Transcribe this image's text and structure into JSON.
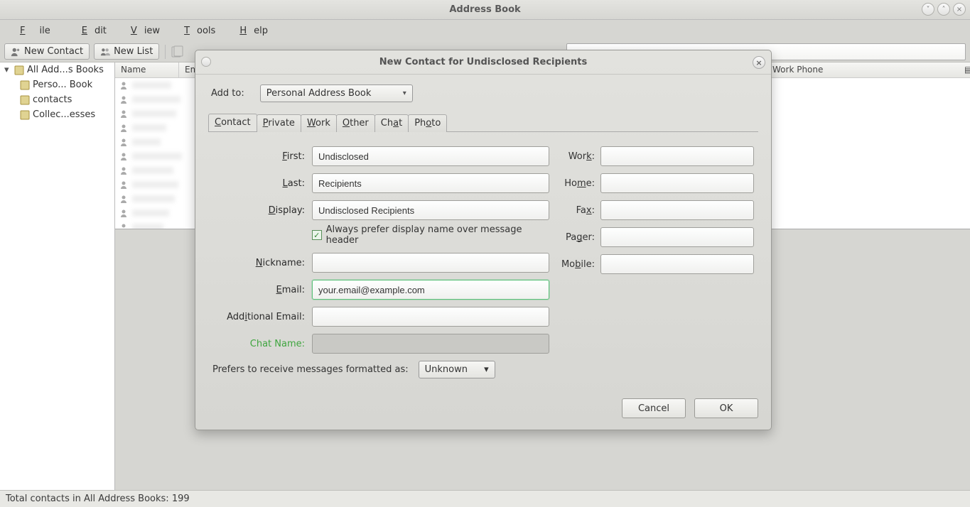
{
  "titlebar": {
    "title": "Address Book"
  },
  "menu": {
    "file": "File",
    "edit": "Edit",
    "view": "View",
    "tools": "Tools",
    "help": "Help"
  },
  "toolbar": {
    "new_contact": "New Contact",
    "new_list": "New List"
  },
  "sidebar": {
    "root": "All Add...s Books",
    "items": [
      "Perso... Book",
      "contacts",
      "Collec...esses"
    ]
  },
  "columns": {
    "name": "Name",
    "email": "Email",
    "work": "Work Phone"
  },
  "status": "Total contacts in All Address Books: 199",
  "dialog": {
    "title": "New Contact for Undisclosed Recipients",
    "add_to_label": "Add to:",
    "add_to_value": "Personal Address Book",
    "tabs": [
      "Contact",
      "Private",
      "Work",
      "Other",
      "Chat",
      "Photo"
    ],
    "left": {
      "first_label": "First:",
      "first": "Undisclosed",
      "last_label": "Last:",
      "last": "Recipients",
      "display_label": "Display:",
      "display": "Undisclosed Recipients",
      "prefer_display": "Always prefer display name over message header",
      "nickname_label": "Nickname:",
      "nickname": "",
      "email_label": "Email:",
      "email": "your.email@example.com",
      "addl_email_label": "Additional Email:",
      "addl_email": "",
      "chat_label": "Chat Name:"
    },
    "right": {
      "work_label": "Work:",
      "home_label": "Home:",
      "fax_label": "Fax:",
      "pager_label": "Pager:",
      "mobile_label": "Mobile:"
    },
    "pref_label": "Prefers to receive messages formatted as:",
    "pref_value": "Unknown",
    "cancel": "Cancel",
    "ok": "OK"
  }
}
